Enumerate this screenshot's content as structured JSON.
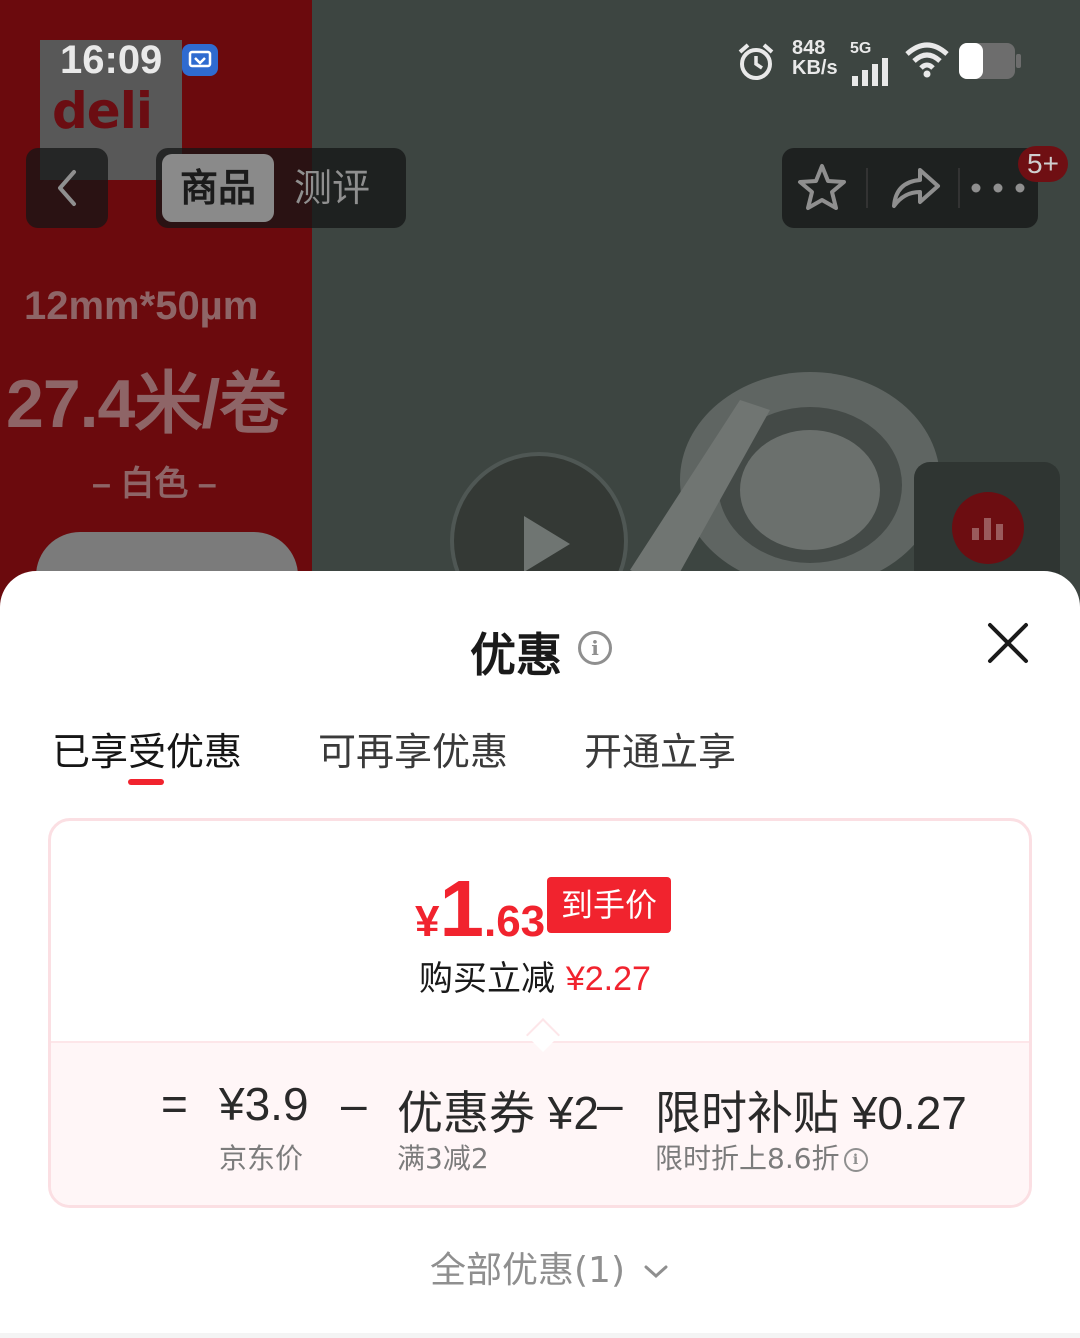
{
  "status_bar": {
    "time": "16:09",
    "speed_top": "848",
    "speed_bottom": "KB/s",
    "network": "5G"
  },
  "background": {
    "brand_logo": "deli",
    "spec_size": "12mm*50µm",
    "spec_length": "27.4米/卷",
    "spec_color": "– 白色 –"
  },
  "top_nav": {
    "tabs": [
      "商品",
      "测评"
    ],
    "badge": "5+"
  },
  "sheet": {
    "title": "优惠",
    "tabs": [
      "已享受优惠",
      "可再享优惠",
      "开通立享"
    ],
    "final_price": {
      "symbol": "¥",
      "integer": "1",
      "decimal": ".63",
      "tag": "到手价"
    },
    "discount_text": "购买立减",
    "discount_amount": "¥2.27",
    "formula": {
      "equals": "=",
      "jd_price": "¥3.9",
      "jd_price_label": "京东价",
      "minus_1": "–",
      "coupon": "优惠券 ¥2",
      "coupon_label": "满3减2",
      "minus_2": "–",
      "subsidy": "限时补贴 ¥0.27",
      "subsidy_label": "限时折上8.6折"
    },
    "all_offers": "全部优惠(1)"
  },
  "colors": {
    "accent": "#f1232e",
    "card_border": "#fbdfe3",
    "card_bottom_bg": "#fff6f7"
  }
}
